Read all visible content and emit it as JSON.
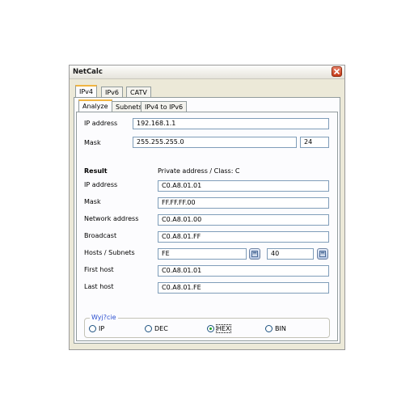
{
  "window": {
    "title": "NetCalc"
  },
  "top_tabs": [
    "IPv4",
    "IPv6",
    "CATV"
  ],
  "sub_tabs": [
    "Analyze",
    "Subnets",
    "IPv4 to IPv6"
  ],
  "input": {
    "ip_label": "IP address",
    "ip_value": "192.168.1.1",
    "mask_label": "Mask",
    "mask_value": "255.255.255.0",
    "mask_bits": "24"
  },
  "result": {
    "heading": "Result",
    "summary": "Private address / Class: C",
    "rows": [
      {
        "label": "IP address",
        "value": "C0.A8.01.01"
      },
      {
        "label": "Mask",
        "value": "FF.FF.FF.00"
      },
      {
        "label": "Network address",
        "value": "C0.A8.01.00"
      },
      {
        "label": "Broadcast",
        "value": "C0.A8.01.FF"
      },
      {
        "label": "Hosts / Subnets",
        "value": "FE",
        "value2": "40"
      },
      {
        "label": "First host",
        "value": "C0.A8.01.01"
      },
      {
        "label": "Last host",
        "value": "C0.A8.01.FE"
      }
    ]
  },
  "output_group": {
    "title": "Wyj?cie",
    "options": [
      "IP",
      "DEC",
      "HEX",
      "BIN"
    ],
    "selected": "HEX"
  }
}
